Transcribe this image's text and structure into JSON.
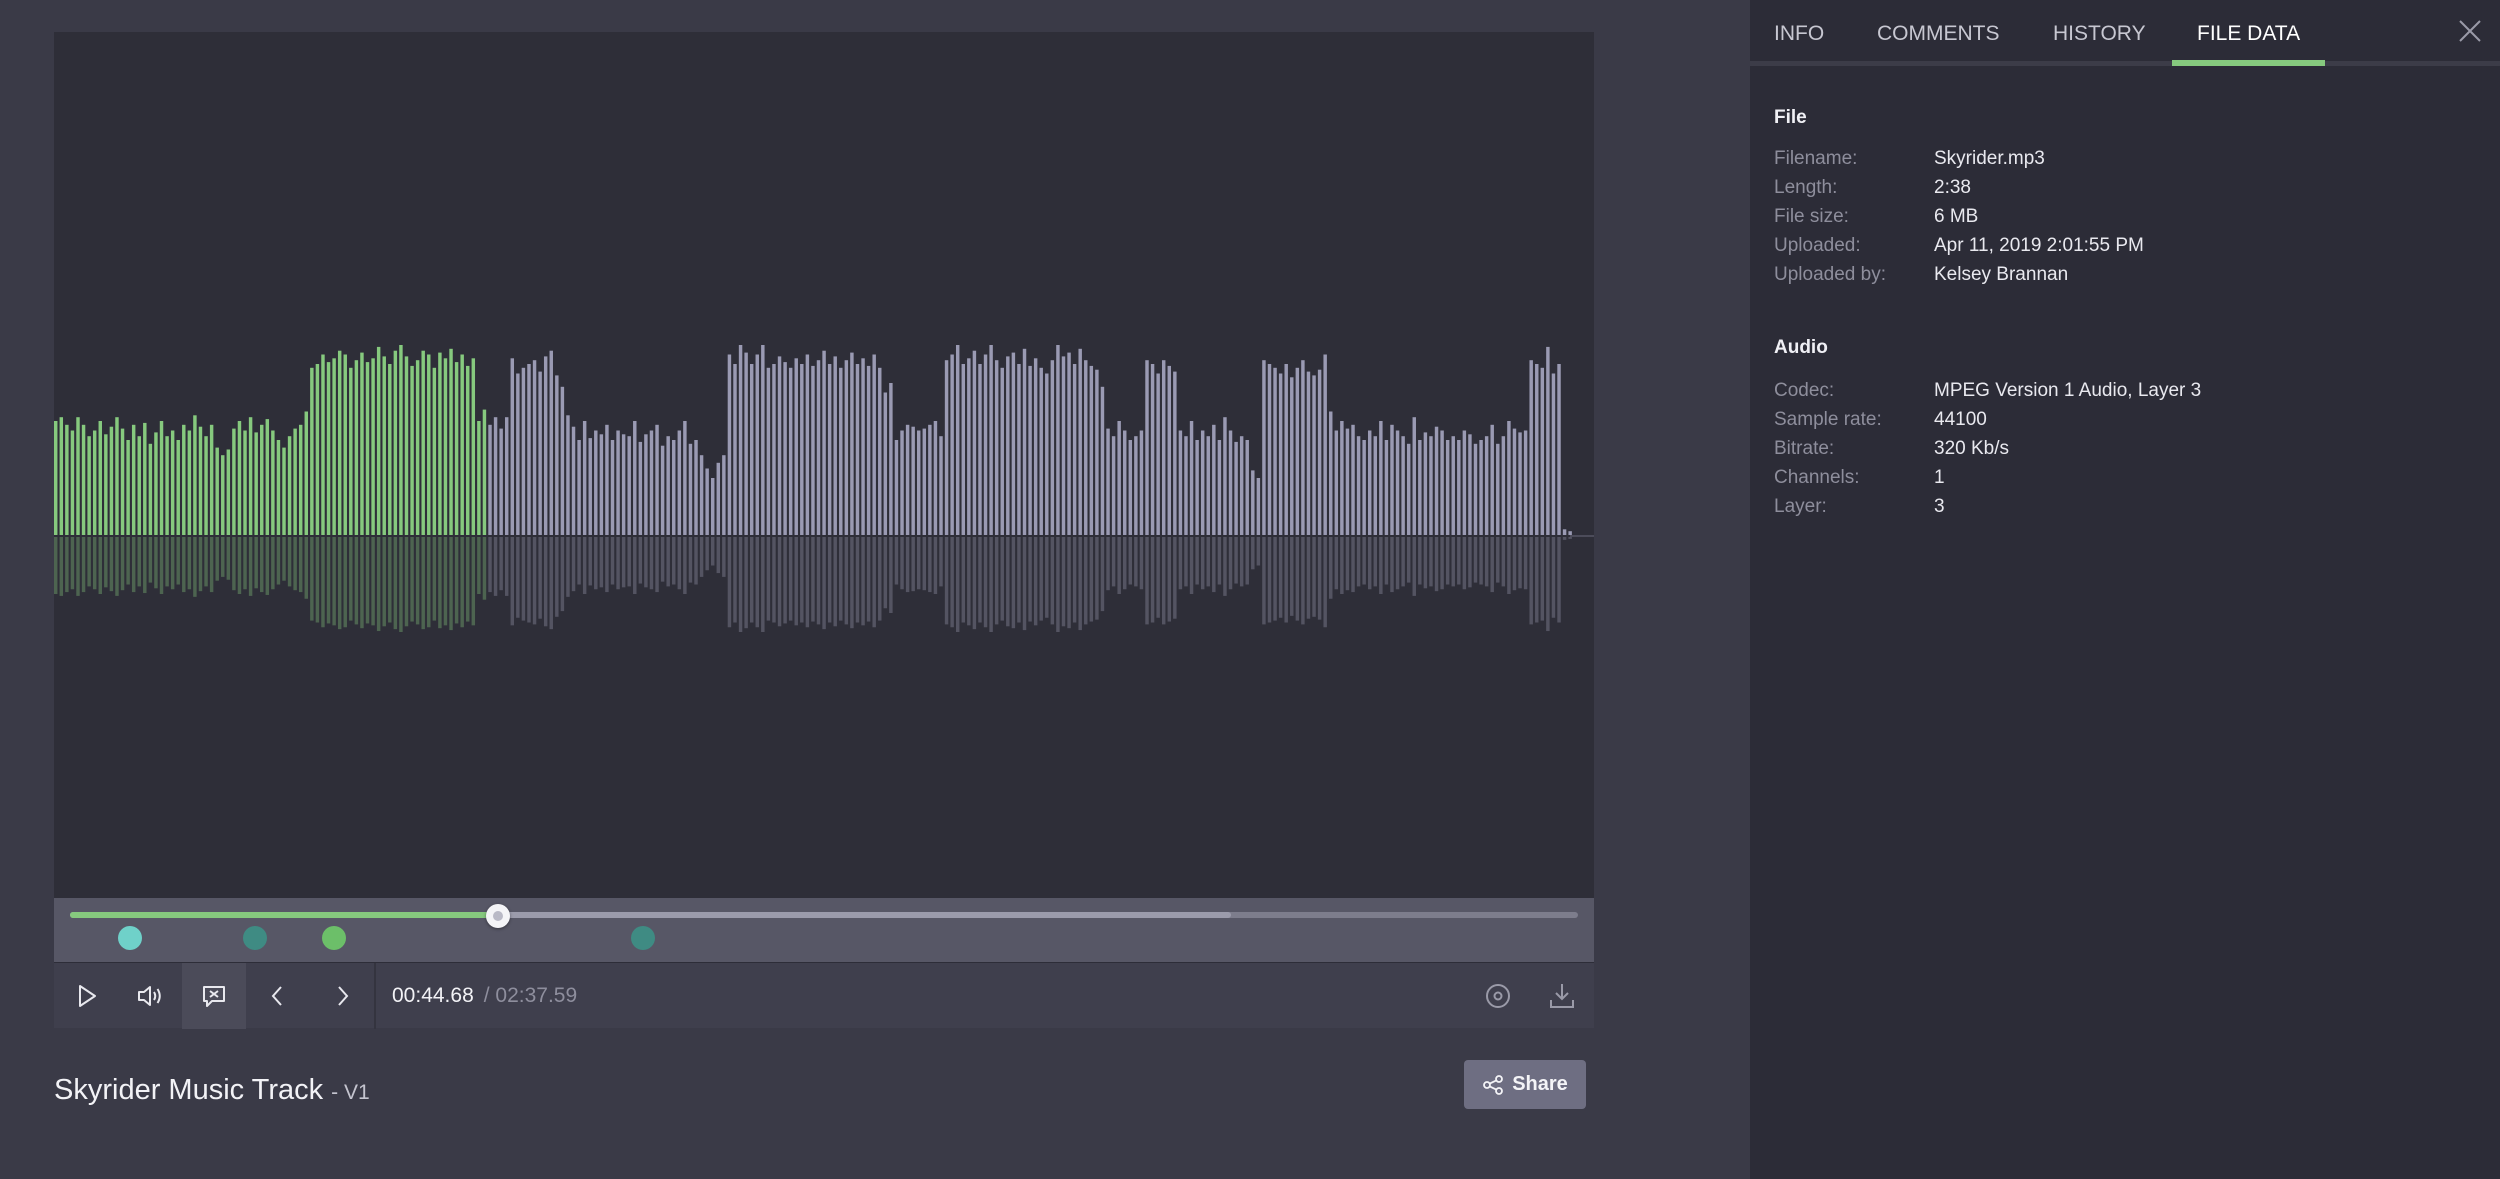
{
  "colors": {
    "played": "#86c97e",
    "unplayed": "#9a9ab3",
    "marker_cyan": "#6fd1c9",
    "marker_teal": "#3f8b83",
    "marker_green": "#6cbf69"
  },
  "player": {
    "progress_fraction": 0.284,
    "buffered_fraction": 0.77,
    "current_time": "00:44.68",
    "total_time": "/ 02:37.59",
    "comment_markers": [
      {
        "position_fraction": 0.04,
        "color": "#6fd1c9"
      },
      {
        "position_fraction": 0.123,
        "color": "#3f8b83"
      },
      {
        "position_fraction": 0.175,
        "color": "#6cbf69"
      },
      {
        "position_fraction": 0.38,
        "color": "#3f8b83"
      }
    ],
    "controls": {
      "play": "play-icon",
      "volume": "volume-icon",
      "comments_toggle": "comment-toggle-icon",
      "previous": "chevron-left-icon",
      "next": "chevron-right-icon",
      "loop": "loop-icon",
      "download": "download-icon"
    }
  },
  "waveform": {
    "bar_count": 238,
    "levels": [
      0.6,
      0.62,
      0.58,
      0.55,
      0.62,
      0.58,
      0.52,
      0.55,
      0.6,
      0.53,
      0.57,
      0.62,
      0.56,
      0.5,
      0.58,
      0.52,
      0.59,
      0.48,
      0.54,
      0.6,
      0.52,
      0.55,
      0.5,
      0.58,
      0.55,
      0.63,
      0.57,
      0.52,
      0.58,
      0.46,
      0.42,
      0.45,
      0.56,
      0.6,
      0.55,
      0.62,
      0.54,
      0.58,
      0.61,
      0.55,
      0.5,
      0.46,
      0.52,
      0.56,
      0.58,
      0.65,
      0.88,
      0.9,
      0.95,
      0.91,
      0.93,
      0.97,
      0.95,
      0.88,
      0.92,
      0.96,
      0.91,
      0.93,
      0.99,
      0.94,
      0.9,
      0.97,
      1.0,
      0.94,
      0.89,
      0.92,
      0.97,
      0.95,
      0.88,
      0.96,
      0.93,
      0.98,
      0.91,
      0.95,
      0.89,
      0.93,
      0.6,
      0.66,
      0.58,
      0.62,
      0.56,
      0.62,
      0.93,
      0.85,
      0.88,
      0.9,
      0.92,
      0.86,
      0.94,
      0.97,
      0.84,
      0.78,
      0.63,
      0.57,
      0.5,
      0.6,
      0.51,
      0.55,
      0.53,
      0.58,
      0.5,
      0.55,
      0.53,
      0.52,
      0.6,
      0.49,
      0.53,
      0.55,
      0.58,
      0.47,
      0.52,
      0.5,
      0.55,
      0.6,
      0.48,
      0.5,
      0.42,
      0.35,
      0.3,
      0.38,
      0.42,
      0.95,
      0.9,
      1.0,
      0.96,
      0.9,
      0.95,
      1.0,
      0.88,
      0.9,
      0.94,
      0.91,
      0.88,
      0.93,
      0.9,
      0.95,
      0.89,
      0.92,
      0.97,
      0.9,
      0.94,
      0.88,
      0.92,
      0.96,
      0.9,
      0.93,
      0.89,
      0.95,
      0.88,
      0.75,
      0.8,
      0.5,
      0.55,
      0.58,
      0.57,
      0.55,
      0.56,
      0.58,
      0.6,
      0.52,
      0.92,
      0.95,
      1.0,
      0.9,
      0.93,
      0.97,
      0.9,
      0.95,
      1.0,
      0.92,
      0.88,
      0.94,
      0.96,
      0.9,
      0.98,
      0.89,
      0.93,
      0.88,
      0.85,
      0.92,
      1.0,
      0.94,
      0.96,
      0.9,
      0.98,
      0.92,
      0.89,
      0.87,
      0.78,
      0.56,
      0.52,
      0.6,
      0.55,
      0.5,
      0.52,
      0.55,
      0.92,
      0.9,
      0.85,
      0.92,
      0.89,
      0.86,
      0.55,
      0.52,
      0.6,
      0.5,
      0.55,
      0.52,
      0.58,
      0.5,
      0.62,
      0.55,
      0.49,
      0.52,
      0.5,
      0.34,
      0.3,
      0.92,
      0.9,
      0.88,
      0.85,
      0.9,
      0.83,
      0.88,
      0.92,
      0.86,
      0.84,
      0.87,
      0.95,
      0.65,
      0.55,
      0.6,
      0.56,
      0.58,
      0.52,
      0.5,
      0.55,
      0.52,
      0.6,
      0.5,
      0.58,
      0.55,
      0.52,
      0.48,
      0.62,
      0.5,
      0.54,
      0.52,
      0.57,
      0.55,
      0.5,
      0.52,
      0.5,
      0.55,
      0.53,
      0.48,
      0.5,
      0.52,
      0.58,
      0.48,
      0.52,
      0.6,
      0.56,
      0.54,
      0.55,
      0.92,
      0.9,
      0.88,
      0.99,
      0.85,
      0.9,
      0.03,
      0.02
    ]
  },
  "track": {
    "title": "Skyrider Music Track",
    "version": "- V1"
  },
  "share": {
    "label": "Share",
    "icon": "share-icon"
  },
  "tabs": [
    {
      "label": "INFO"
    },
    {
      "label": "COMMENTS"
    },
    {
      "label": "HISTORY"
    },
    {
      "label": "FILE DATA",
      "active": true
    }
  ],
  "file_section": {
    "title": "File",
    "rows": [
      {
        "key": "Filename:",
        "value": "Skyrider.mp3"
      },
      {
        "key": "Length:",
        "value": "2:38"
      },
      {
        "key": "File size:",
        "value": "6 MB"
      },
      {
        "key": "Uploaded:",
        "value": "Apr 11, 2019 2:01:55 PM"
      },
      {
        "key": "Uploaded by:",
        "value": "Kelsey Brannan"
      }
    ]
  },
  "audio_section": {
    "title": "Audio",
    "rows": [
      {
        "key": "Codec:",
        "value": "MPEG Version 1 Audio, Layer 3"
      },
      {
        "key": "Sample rate:",
        "value": "44100"
      },
      {
        "key": "Bitrate:",
        "value": "320 Kb/s"
      },
      {
        "key": "Channels:",
        "value": "1"
      },
      {
        "key": "Layer:",
        "value": "3"
      }
    ]
  }
}
